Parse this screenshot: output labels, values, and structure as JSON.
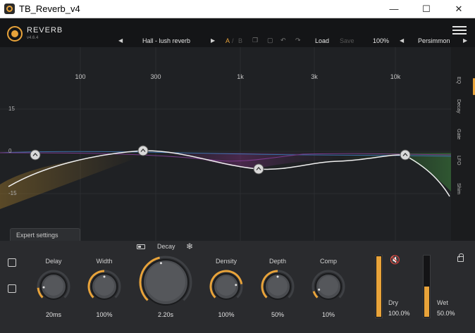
{
  "window": {
    "title": "TB_Reverb_v4",
    "min": "—",
    "max": "☐",
    "close": "✕"
  },
  "header": {
    "name": "REVERB",
    "version": "v4.6.4"
  },
  "preset": {
    "prev": "◀",
    "next": "▶",
    "name": "Hall - lush reverb",
    "a": "A",
    "sep": "/",
    "b": "B",
    "load": "Load",
    "save": "Save",
    "zoom": "100%",
    "theme": "Persimmon"
  },
  "eq": {
    "freq_labels": [
      "100",
      "300",
      "1k",
      "3k",
      "10k"
    ],
    "gain_labels": [
      "15",
      "0",
      "-15"
    ],
    "nodes": [
      {
        "freq_label": "below 100",
        "gain_db": 0,
        "type": "low-shelf"
      },
      {
        "freq_label": "≈300",
        "gain_db": 2,
        "type": "bell"
      },
      {
        "freq_label": "≈1.5k",
        "gain_db": -6,
        "type": "bell"
      },
      {
        "freq_label": "≈10k",
        "gain_db": 0,
        "type": "high-shelf"
      }
    ]
  },
  "tabs": [
    "EQ",
    "Decay",
    "Gate",
    "LFO",
    "Shim"
  ],
  "expert_label": "Expert settings",
  "controls": {
    "delay": {
      "label": "Delay",
      "value": "20ms",
      "fraction": 0.15
    },
    "width": {
      "label": "Width",
      "value": "100%",
      "fraction": 0.5
    },
    "decay": {
      "label": "Decay",
      "value": "2.20s",
      "fraction": 0.45
    },
    "density": {
      "label": "Density",
      "value": "100%",
      "fraction": 0.8
    },
    "depth": {
      "label": "Depth",
      "value": "50%",
      "fraction": 0.5
    },
    "comp": {
      "label": "Comp",
      "value": "10%",
      "fraction": 0.1
    }
  },
  "mix": {
    "dry": {
      "label": "Dry",
      "value": "100.0%",
      "fraction": 1.0
    },
    "wet": {
      "label": "Wet",
      "value": "50.0%",
      "fraction": 0.5
    }
  },
  "icons": {
    "freeze": "❄",
    "mute": "🔇"
  },
  "colors": {
    "accent": "#e8a33a",
    "background": "#1f2124"
  }
}
